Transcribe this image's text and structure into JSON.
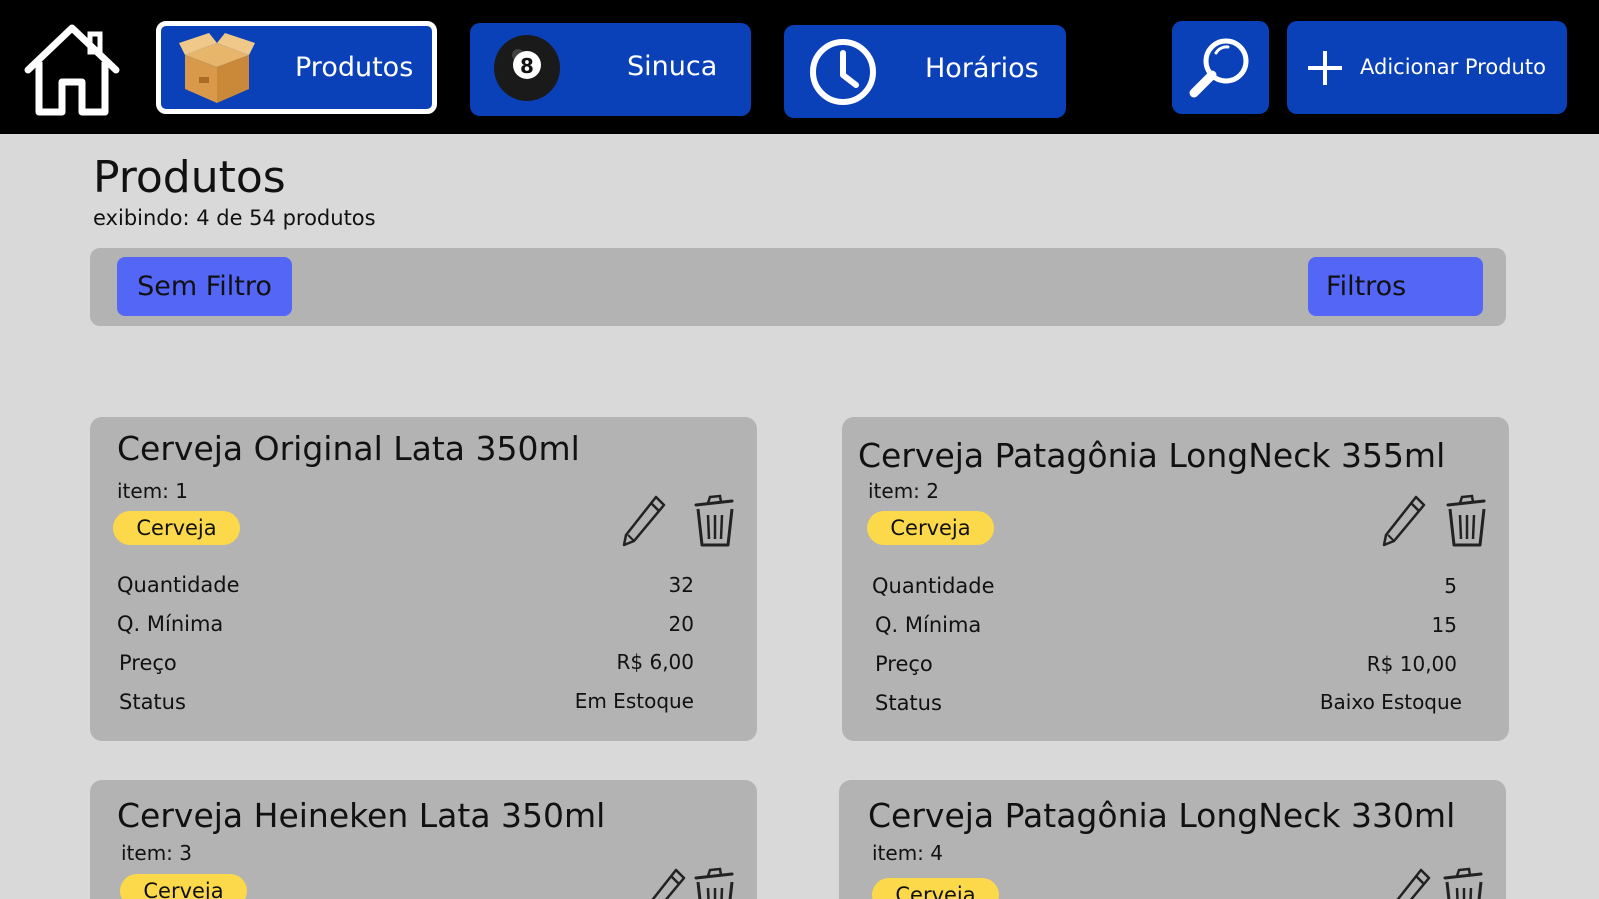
{
  "nav": {
    "produtos_label": "Produtos",
    "sinuca_label": "Sinuca",
    "horarios_label": "Horários",
    "add_label": "Adicionar Produto",
    "sinuca_ball_number": "8"
  },
  "page": {
    "title": "Produtos",
    "subtitle": "exibindo: 4 de 54 produtos"
  },
  "filters": {
    "sem_filtro_label": "Sem Filtro",
    "filtros_label": "Filtros"
  },
  "labels": {
    "quantidade": "Quantidade",
    "q_minima": "Q. Mínima",
    "preco": "Preço",
    "status": "Status"
  },
  "products": [
    {
      "name": "Cerveja Original Lata 350ml",
      "item": "item: 1",
      "category": "Cerveja",
      "quantidade": "32",
      "q_minima": "20",
      "preco": "R$ 6,00",
      "status": "Em Estoque"
    },
    {
      "name": "Cerveja Patagônia LongNeck 355ml",
      "item": "item: 2",
      "category": "Cerveja",
      "quantidade": "5",
      "q_minima": "15",
      "preco": "R$ 10,00",
      "status": "Baixo Estoque"
    },
    {
      "name": "Cerveja Heineken Lata 350ml",
      "item": "item: 3",
      "category": "Cerveja"
    },
    {
      "name": "Cerveja Patagônia LongNeck 330ml",
      "item": "item: 4",
      "category": "Cerveja"
    }
  ],
  "colors": {
    "topbar": "#000000",
    "nav_button": "#0a40b8",
    "filter_button": "#5466f5",
    "badge": "#fcd94a",
    "card": "#b3b3b3",
    "background": "#d9d9d9"
  },
  "icons": {
    "home": "home-icon",
    "produtos": "box-icon",
    "sinuca": "billiard-ball-icon",
    "horarios": "clock-icon",
    "search": "search-icon",
    "add": "plus-icon",
    "edit": "pencil-icon",
    "delete": "trash-icon"
  }
}
